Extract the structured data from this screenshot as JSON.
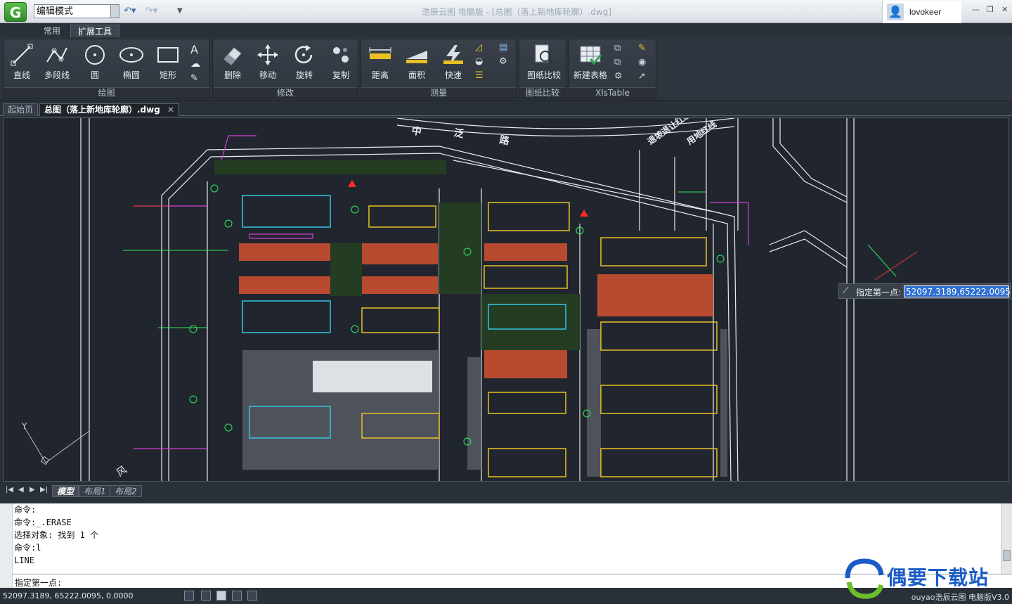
{
  "titlebar": {
    "mode": "编辑模式",
    "window_title": "浩辰云图 电脑版 - [总图（落上新地库轮廓）.dwg]",
    "username": "lovokeer"
  },
  "ribbon_tabs": [
    "常用",
    "扩展工具"
  ],
  "groups": {
    "draw": {
      "label": "绘图",
      "tools": [
        "直线",
        "多段线",
        "圆",
        "椭圆",
        "矩形"
      ]
    },
    "modify": {
      "label": "修改",
      "tools": [
        "删除",
        "移动",
        "旋转",
        "复制"
      ]
    },
    "measure": {
      "label": "测量",
      "tools": [
        "距离",
        "面积",
        "快速"
      ]
    },
    "compare": {
      "label": "图纸比较",
      "tools": [
        "图纸比较"
      ]
    },
    "xls": {
      "label": "XlsTable",
      "tools": [
        "新建表格"
      ]
    }
  },
  "doc_tabs": [
    "起始页",
    "总图（落上新地库轮廓）.dwg"
  ],
  "drawing_labels": {
    "road1": "中",
    "road2": "泛",
    "road3": "路",
    "road4": "退坡退让红线",
    "road5": "用地红线",
    "axis_y": "Y",
    "corner": "风"
  },
  "cmd_popup": {
    "label": "指定第一点:",
    "value": "52097.3189,65222.0095"
  },
  "layout_tabs": [
    "模型",
    "布局1",
    "布局2"
  ],
  "command_history": [
    "命令:",
    "命令:_.ERASE",
    "选择对象: 找到 1 个",
    "命令:l",
    "LINE"
  ],
  "command_prompt": "指定第一点:",
  "status": {
    "coords": "52097.3189, 65222.0095, 0.0000",
    "version": "ouyao浩辰云图 电脑版V3.0"
  },
  "watermark": "偶要下载站",
  "colors": {
    "canvas_bg": "#21262e",
    "accent": "#2d6fd2",
    "hatch_red": "#c0392b",
    "cad_yellow": "#e8c026",
    "cad_green": "#2ee85a"
  }
}
